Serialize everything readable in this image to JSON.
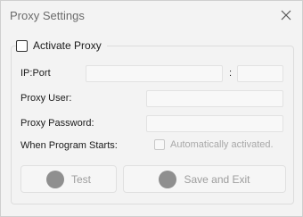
{
  "window": {
    "title": "Proxy Settings"
  },
  "group": {
    "activate_label": "Activate Proxy",
    "activate_checked": false
  },
  "fields": {
    "ip_port_label": "IP:Port",
    "colon": ":",
    "ip_value": "",
    "port_value": "",
    "proxy_user_label": "Proxy User:",
    "proxy_user_value": "",
    "proxy_password_label": "Proxy Password:",
    "proxy_password_value": ""
  },
  "startup": {
    "label": "When Program Starts:",
    "auto_label": "Automatically activated.",
    "auto_checked": false
  },
  "buttons": {
    "test_label": "Test",
    "save_label": "Save and Exit"
  }
}
